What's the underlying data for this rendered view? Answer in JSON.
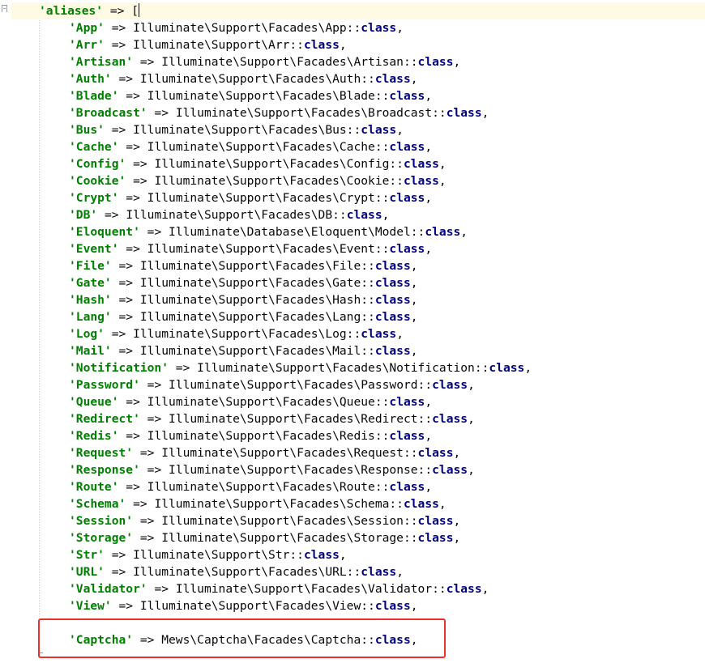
{
  "editor": {
    "accent_color": "#e8322b",
    "opening_line": {
      "key": "'aliases'",
      "arrow": " => ",
      "bracket": "["
    },
    "entries": [
      {
        "key": "'App'",
        "path": "Illuminate\\Support\\Facades\\App::",
        "kw": "class",
        "tail": ","
      },
      {
        "key": "'Arr'",
        "path": "Illuminate\\Support\\Arr::",
        "kw": "class",
        "tail": ","
      },
      {
        "key": "'Artisan'",
        "path": "Illuminate\\Support\\Facades\\Artisan::",
        "kw": "class",
        "tail": ","
      },
      {
        "key": "'Auth'",
        "path": "Illuminate\\Support\\Facades\\Auth::",
        "kw": "class",
        "tail": ","
      },
      {
        "key": "'Blade'",
        "path": "Illuminate\\Support\\Facades\\Blade::",
        "kw": "class",
        "tail": ","
      },
      {
        "key": "'Broadcast'",
        "path": "Illuminate\\Support\\Facades\\Broadcast::",
        "kw": "class",
        "tail": ","
      },
      {
        "key": "'Bus'",
        "path": "Illuminate\\Support\\Facades\\Bus::",
        "kw": "class",
        "tail": ","
      },
      {
        "key": "'Cache'",
        "path": "Illuminate\\Support\\Facades\\Cache::",
        "kw": "class",
        "tail": ","
      },
      {
        "key": "'Config'",
        "path": "Illuminate\\Support\\Facades\\Config::",
        "kw": "class",
        "tail": ","
      },
      {
        "key": "'Cookie'",
        "path": "Illuminate\\Support\\Facades\\Cookie::",
        "kw": "class",
        "tail": ","
      },
      {
        "key": "'Crypt'",
        "path": "Illuminate\\Support\\Facades\\Crypt::",
        "kw": "class",
        "tail": ","
      },
      {
        "key": "'DB'",
        "path": "Illuminate\\Support\\Facades\\DB::",
        "kw": "class",
        "tail": ","
      },
      {
        "key": "'Eloquent'",
        "path": "Illuminate\\Database\\Eloquent\\Model::",
        "kw": "class",
        "tail": ","
      },
      {
        "key": "'Event'",
        "path": "Illuminate\\Support\\Facades\\Event::",
        "kw": "class",
        "tail": ","
      },
      {
        "key": "'File'",
        "path": "Illuminate\\Support\\Facades\\File::",
        "kw": "class",
        "tail": ","
      },
      {
        "key": "'Gate'",
        "path": "Illuminate\\Support\\Facades\\Gate::",
        "kw": "class",
        "tail": ","
      },
      {
        "key": "'Hash'",
        "path": "Illuminate\\Support\\Facades\\Hash::",
        "kw": "class",
        "tail": ","
      },
      {
        "key": "'Lang'",
        "path": "Illuminate\\Support\\Facades\\Lang::",
        "kw": "class",
        "tail": ","
      },
      {
        "key": "'Log'",
        "path": "Illuminate\\Support\\Facades\\Log::",
        "kw": "class",
        "tail": ","
      },
      {
        "key": "'Mail'",
        "path": "Illuminate\\Support\\Facades\\Mail::",
        "kw": "class",
        "tail": ","
      },
      {
        "key": "'Notification'",
        "path": "Illuminate\\Support\\Facades\\Notification::",
        "kw": "class",
        "tail": ","
      },
      {
        "key": "'Password'",
        "path": "Illuminate\\Support\\Facades\\Password::",
        "kw": "class",
        "tail": ","
      },
      {
        "key": "'Queue'",
        "path": "Illuminate\\Support\\Facades\\Queue::",
        "kw": "class",
        "tail": ","
      },
      {
        "key": "'Redirect'",
        "path": "Illuminate\\Support\\Facades\\Redirect::",
        "kw": "class",
        "tail": ","
      },
      {
        "key": "'Redis'",
        "path": "Illuminate\\Support\\Facades\\Redis::",
        "kw": "class",
        "tail": ","
      },
      {
        "key": "'Request'",
        "path": "Illuminate\\Support\\Facades\\Request::",
        "kw": "class",
        "tail": ","
      },
      {
        "key": "'Response'",
        "path": "Illuminate\\Support\\Facades\\Response::",
        "kw": "class",
        "tail": ","
      },
      {
        "key": "'Route'",
        "path": "Illuminate\\Support\\Facades\\Route::",
        "kw": "class",
        "tail": ","
      },
      {
        "key": "'Schema'",
        "path": "Illuminate\\Support\\Facades\\Schema::",
        "kw": "class",
        "tail": ","
      },
      {
        "key": "'Session'",
        "path": "Illuminate\\Support\\Facades\\Session::",
        "kw": "class",
        "tail": ","
      },
      {
        "key": "'Storage'",
        "path": "Illuminate\\Support\\Facades\\Storage::",
        "kw": "class",
        "tail": ","
      },
      {
        "key": "'Str'",
        "path": "Illuminate\\Support\\Str::",
        "kw": "class",
        "tail": ","
      },
      {
        "key": "'URL'",
        "path": "Illuminate\\Support\\Facades\\URL::",
        "kw": "class",
        "tail": ","
      },
      {
        "key": "'Validator'",
        "path": "Illuminate\\Support\\Facades\\Validator::",
        "kw": "class",
        "tail": ","
      },
      {
        "key": "'View'",
        "path": "Illuminate\\Support\\Facades\\View::",
        "kw": "class",
        "tail": ","
      }
    ],
    "highlighted_entry": {
      "key": "'Captcha'",
      "path": "Mews\\Captcha\\Facades\\Captcha::",
      "kw": "class",
      "tail": ","
    },
    "arrow": " => "
  }
}
